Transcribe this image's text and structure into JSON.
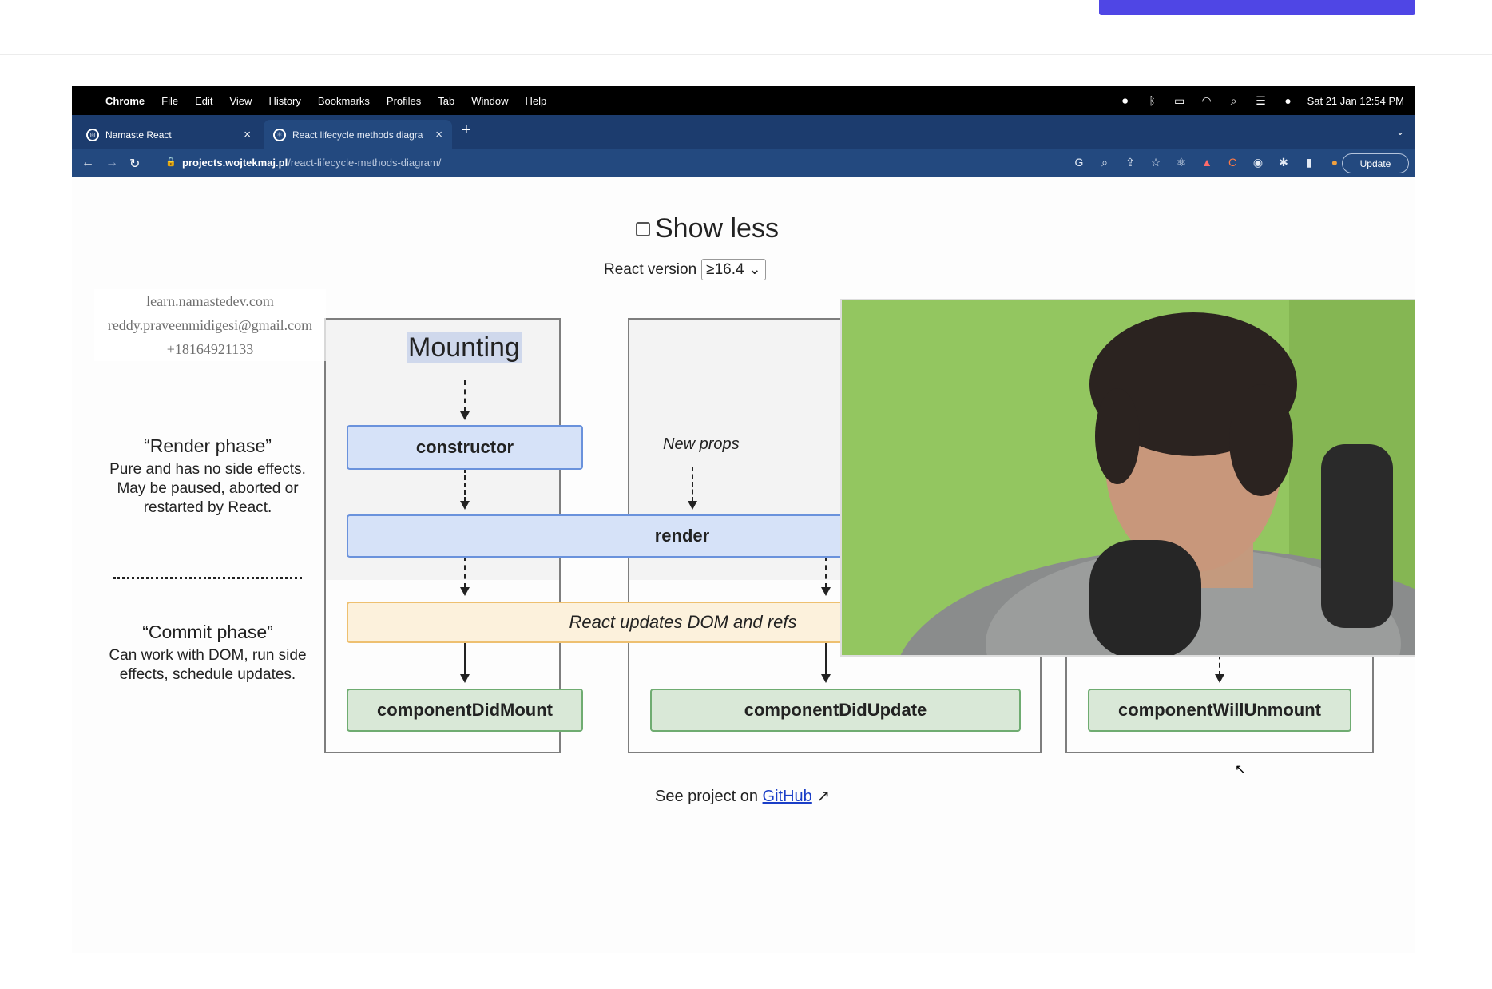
{
  "menubar": {
    "app": "Chrome",
    "items": [
      "File",
      "Edit",
      "View",
      "History",
      "Bookmarks",
      "Profiles",
      "Tab",
      "Window",
      "Help"
    ],
    "datetime": "Sat 21 Jan  12:54 PM"
  },
  "tabs": [
    {
      "label": "Namaste React"
    },
    {
      "label": "React lifecycle methods diagra"
    }
  ],
  "address": {
    "host": "projects.wojtekmaj.pl",
    "path": "/react-lifecycle-methods-diagram/",
    "update_label": "Update"
  },
  "page": {
    "show_less": "Show less",
    "react_version_label": "React version",
    "react_version_value": "≥16.4",
    "watermark": {
      "line1": "learn.namastedev.com",
      "line2": "reddy.praveenmidigesi@gmail.com",
      "line3": "+18164921133"
    },
    "render_phase": {
      "title": "“Render phase”",
      "desc": "Pure and has no side effects. May be paused, aborted or restarted by React."
    },
    "commit_phase": {
      "title": "“Commit phase”",
      "desc": "Can work with DOM, run side effects, schedule updates."
    },
    "columns": {
      "mounting": "Mounting"
    },
    "nodes": {
      "constructor": "constructor",
      "new_props": "New props",
      "render": "render",
      "react_updates": "React updates DOM and refs",
      "did_mount": "componentDidMount",
      "did_update": "componentDidUpdate",
      "will_unmount": "componentWillUnmount"
    },
    "footer": {
      "prefix": "See project on",
      "link": "GitHub"
    }
  },
  "colors": {
    "accent": "#4f46e5",
    "tabbar": "#1c3c6e",
    "addrbar": "#23497f",
    "render_node": "#d6e2f8",
    "commit_node": "#d9e8d7",
    "dom_node": "#fcf1dc",
    "webcam_bg": "#8fc25c"
  }
}
